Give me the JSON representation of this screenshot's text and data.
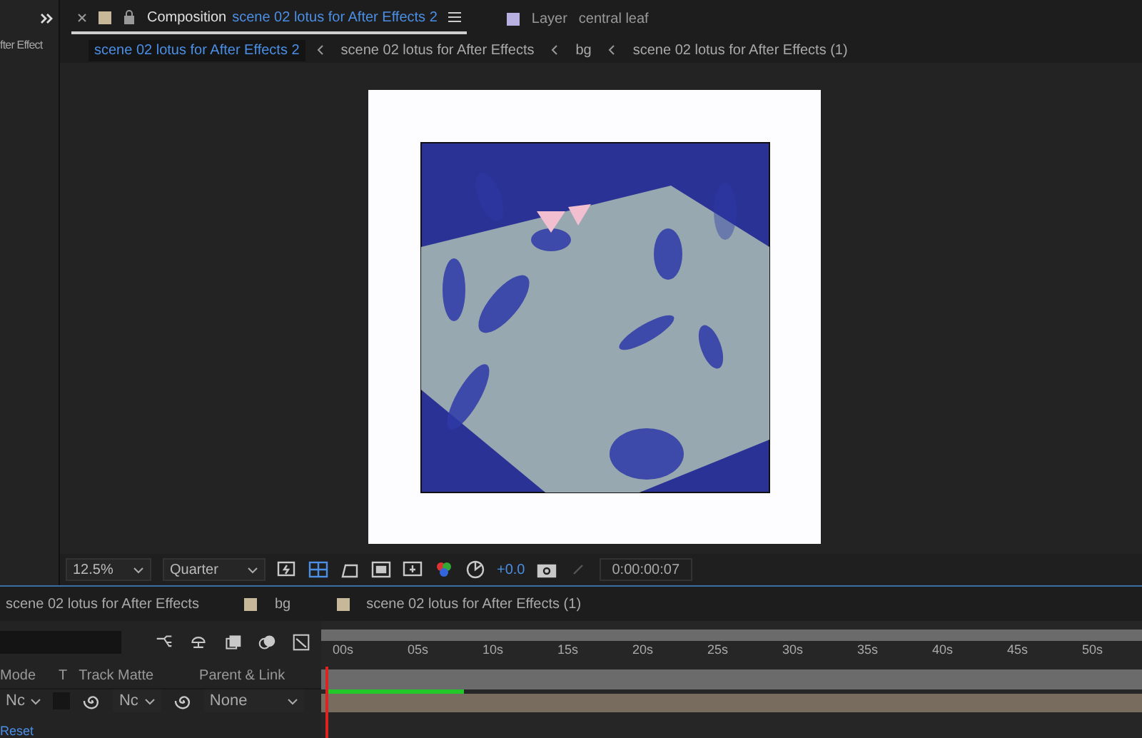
{
  "left_panel": {
    "label": "fter Effect",
    "link": "Reset"
  },
  "viewer_tabs": [
    {
      "kind": "composition",
      "prefix": "Composition",
      "label": "scene 02 lotus for After Effects 2",
      "selected": true
    },
    {
      "kind": "layer",
      "prefix": "Layer",
      "label": "central leaf",
      "selected": false
    }
  ],
  "breadcrumbs": [
    {
      "label": "scene 02 lotus for After Effects 2",
      "selected": true
    },
    {
      "label": "scene 02 lotus for After Effects",
      "selected": false
    },
    {
      "label": "bg",
      "selected": false
    },
    {
      "label": "scene 02 lotus for After Effects (1)",
      "selected": false
    }
  ],
  "viewer_toolbar": {
    "zoom": "12.5%",
    "resolution": "Quarter",
    "exposure": "+0.0",
    "timecode": "0:00:00:07"
  },
  "timeline_tabs": [
    {
      "label": "scene 02 lotus for After Effects"
    },
    {
      "label": "bg",
      "color": "#c8b89a"
    },
    {
      "label": "scene 02 lotus for After Effects (1)",
      "color": "#c8b89a"
    }
  ],
  "timeline": {
    "columns": [
      "Mode",
      "T",
      "Track Matte",
      "Parent & Link"
    ],
    "row": {
      "mode": "Nc",
      "track_matte": "Nc",
      "parent": "None"
    },
    "ruler": [
      "00s",
      "05s",
      "10s",
      "15s",
      "20s",
      "25s",
      "30s",
      "35s",
      "40s",
      "45s",
      "50s"
    ]
  }
}
